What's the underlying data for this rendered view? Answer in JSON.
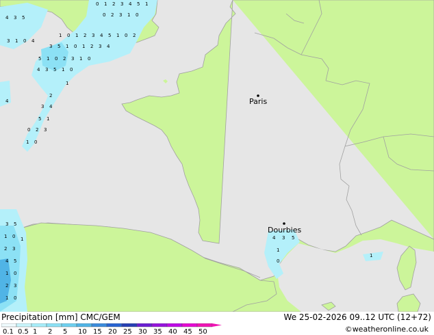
{
  "map": {
    "cities": [
      {
        "name": "Paris"
      },
      {
        "name": "Dourbies"
      }
    ],
    "precip_marks": [
      "0",
      "1",
      "2",
      "3",
      "4",
      "5",
      "1",
      "0",
      "2",
      "3",
      "1",
      "0",
      "4",
      "3",
      "5",
      "1"
    ],
    "colors": {
      "land": "#ccf59a",
      "sea": "#e6e6e6",
      "precip_light": "#b4f0fa",
      "precip_mid": "#8ce1f5",
      "precip_heavy": "#50b4e6",
      "border": "#a0a0a0"
    }
  },
  "footer": {
    "title": "Precipitation [mm]  CMC/GEM",
    "valid_time": "We 25-02-2026 09..12 UTC (12+72)",
    "copyright": "©weatheronline.co.uk",
    "legend_labels": [
      "0.1",
      "0.5",
      "1",
      "2",
      "5",
      "10",
      "15",
      "20",
      "25",
      "30",
      "35",
      "40",
      "45",
      "50"
    ],
    "legend_colors": [
      "#f0fcfe",
      "#c8f5fc",
      "#a8eefa",
      "#8ce1f5",
      "#6ed0f0",
      "#50b4e6",
      "#3c8cdc",
      "#2864d2",
      "#2840b4",
      "#6a1ed2",
      "#9614dc",
      "#be0ae6",
      "#e60ad2",
      "#f014b4"
    ]
  }
}
